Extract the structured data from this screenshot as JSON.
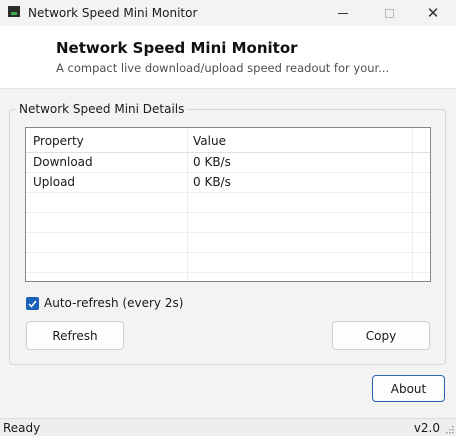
{
  "window": {
    "title": "Network Speed Mini Monitor",
    "close_glyph": "✕"
  },
  "header": {
    "title": "Network Speed Mini Monitor",
    "subtitle": "A compact live download/upload speed readout for your..."
  },
  "group": {
    "label": "Network Speed Mini Details"
  },
  "table": {
    "columns": [
      "Property",
      "Value"
    ],
    "rows": [
      {
        "property": "Download",
        "value": "0 KB/s"
      },
      {
        "property": "Upload",
        "value": "0 KB/s"
      }
    ]
  },
  "auto_refresh": {
    "label": "Auto-refresh (every 2s)",
    "checked": true
  },
  "buttons": {
    "refresh": "Refresh",
    "copy": "Copy",
    "about": "About"
  },
  "status": {
    "left": "Ready",
    "right": "v2.0"
  },
  "colors": {
    "accent": "#1a62b8",
    "about_border": "#2a63b2"
  }
}
